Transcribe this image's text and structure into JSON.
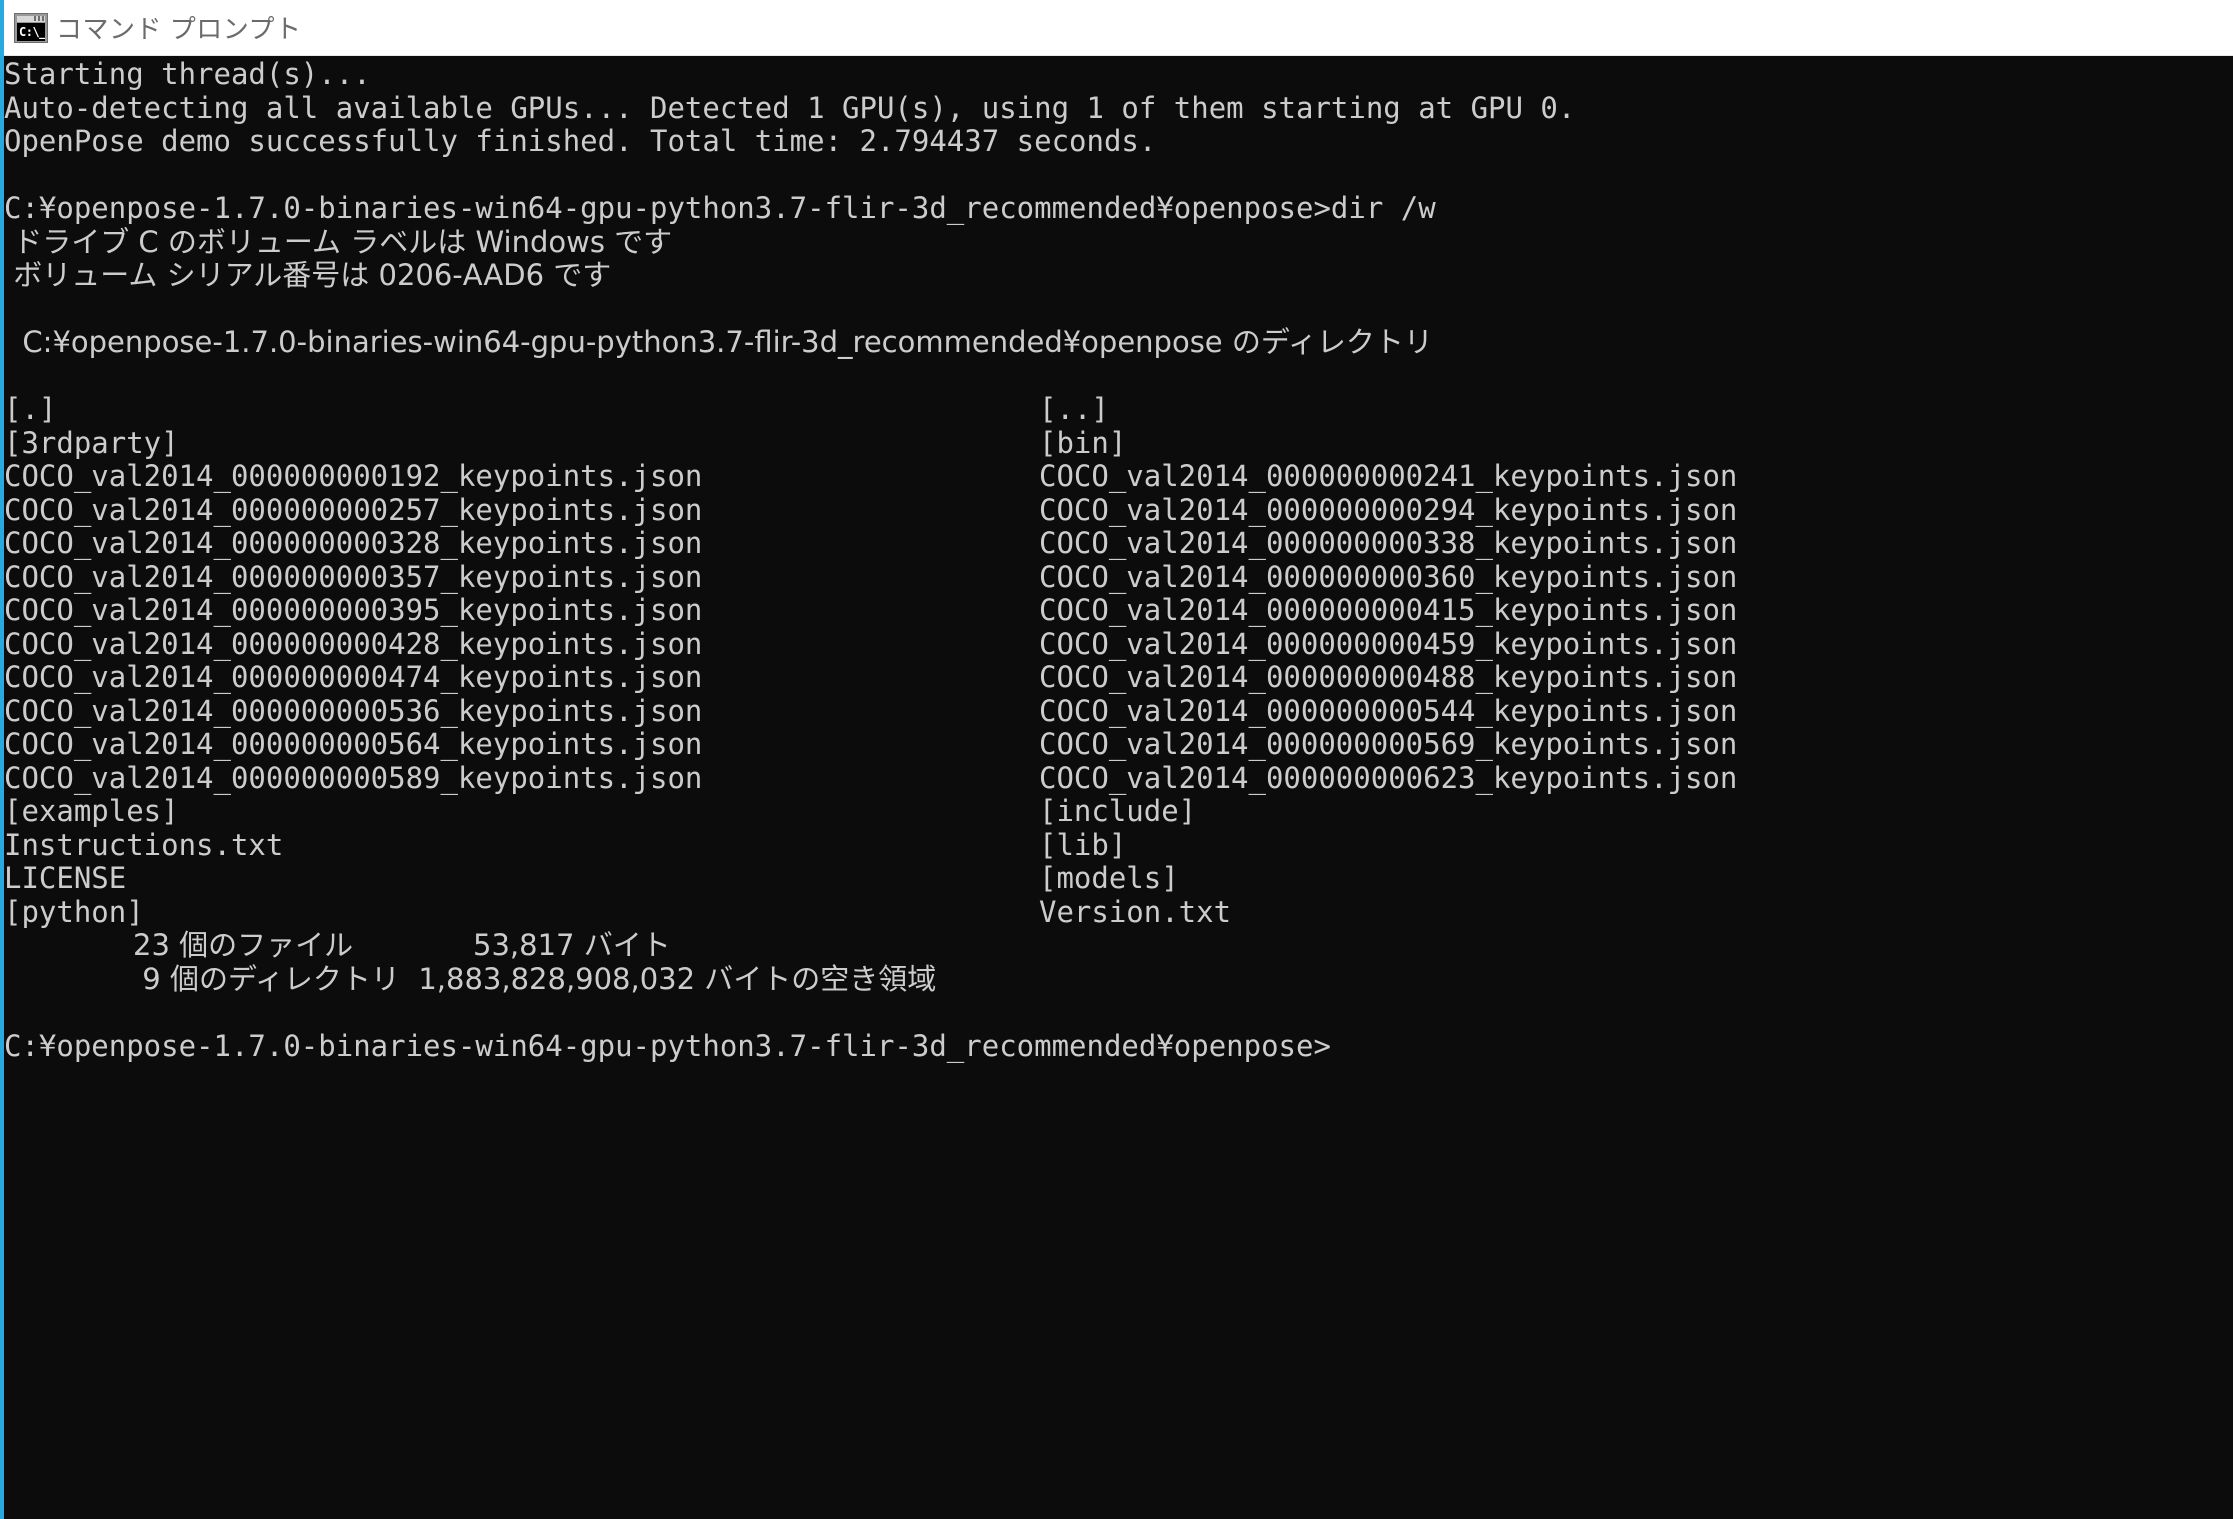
{
  "window": {
    "title": "コマンド プロンプト",
    "icon": "cmd-prompt-icon",
    "icon_glyph": "C:\\_",
    "titlebar_bg": "#ffffff",
    "title_color": "#6b6b6b",
    "console_bg": "#0c0c0c",
    "console_fg": "#cccccc",
    "accent": "#2aa8e0"
  },
  "console": {
    "lines": [
      "Starting thread(s)...",
      "Auto-detecting all available GPUs... Detected 1 GPU(s), using 1 of them starting at GPU 0.",
      "OpenPose demo successfully finished. Total time: 2.794437 seconds.",
      "",
      "C:¥openpose-1.7.0-binaries-win64-gpu-python3.7-flir-3d_recommended¥openpose>dir /w",
      " ドライブ C のボリューム ラベルは Windows です",
      " ボリューム シリアル番号は 0206-AAD6 です",
      "",
      "  C:¥openpose-1.7.0-binaries-win64-gpu-python3.7-flir-3d_recommended¥openpose のディレクトリ",
      ""
    ],
    "dir_rows": [
      {
        "col1": "[.]",
        "col2": "[..]"
      },
      {
        "col1": "[3rdparty]",
        "col2": "[bin]"
      },
      {
        "col1": "COCO_val2014_000000000192_keypoints.json",
        "col2": "COCO_val2014_000000000241_keypoints.json"
      },
      {
        "col1": "COCO_val2014_000000000257_keypoints.json",
        "col2": "COCO_val2014_000000000294_keypoints.json"
      },
      {
        "col1": "COCO_val2014_000000000328_keypoints.json",
        "col2": "COCO_val2014_000000000338_keypoints.json"
      },
      {
        "col1": "COCO_val2014_000000000357_keypoints.json",
        "col2": "COCO_val2014_000000000360_keypoints.json"
      },
      {
        "col1": "COCO_val2014_000000000395_keypoints.json",
        "col2": "COCO_val2014_000000000415_keypoints.json"
      },
      {
        "col1": "COCO_val2014_000000000428_keypoints.json",
        "col2": "COCO_val2014_000000000459_keypoints.json"
      },
      {
        "col1": "COCO_val2014_000000000474_keypoints.json",
        "col2": "COCO_val2014_000000000488_keypoints.json"
      },
      {
        "col1": "COCO_val2014_000000000536_keypoints.json",
        "col2": "COCO_val2014_000000000544_keypoints.json"
      },
      {
        "col1": "COCO_val2014_000000000564_keypoints.json",
        "col2": "COCO_val2014_000000000569_keypoints.json"
      },
      {
        "col1": "COCO_val2014_000000000589_keypoints.json",
        "col2": "COCO_val2014_000000000623_keypoints.json"
      },
      {
        "col1": "[examples]",
        "col2": "[include]"
      },
      {
        "col1": "Instructions.txt",
        "col2": "[lib]"
      },
      {
        "col1": "LICENSE",
        "col2": "[models]"
      },
      {
        "col1": "[python]",
        "col2": "Version.txt"
      }
    ],
    "summary": [
      "              23 個のファイル             53,817 バイト",
      "               9 個のディレクトリ  1,883,828,908,032 バイトの空き領域",
      ""
    ],
    "final_prompt": "C:¥openpose-1.7.0-binaries-win64-gpu-python3.7-flir-3d_recommended¥openpose>"
  }
}
